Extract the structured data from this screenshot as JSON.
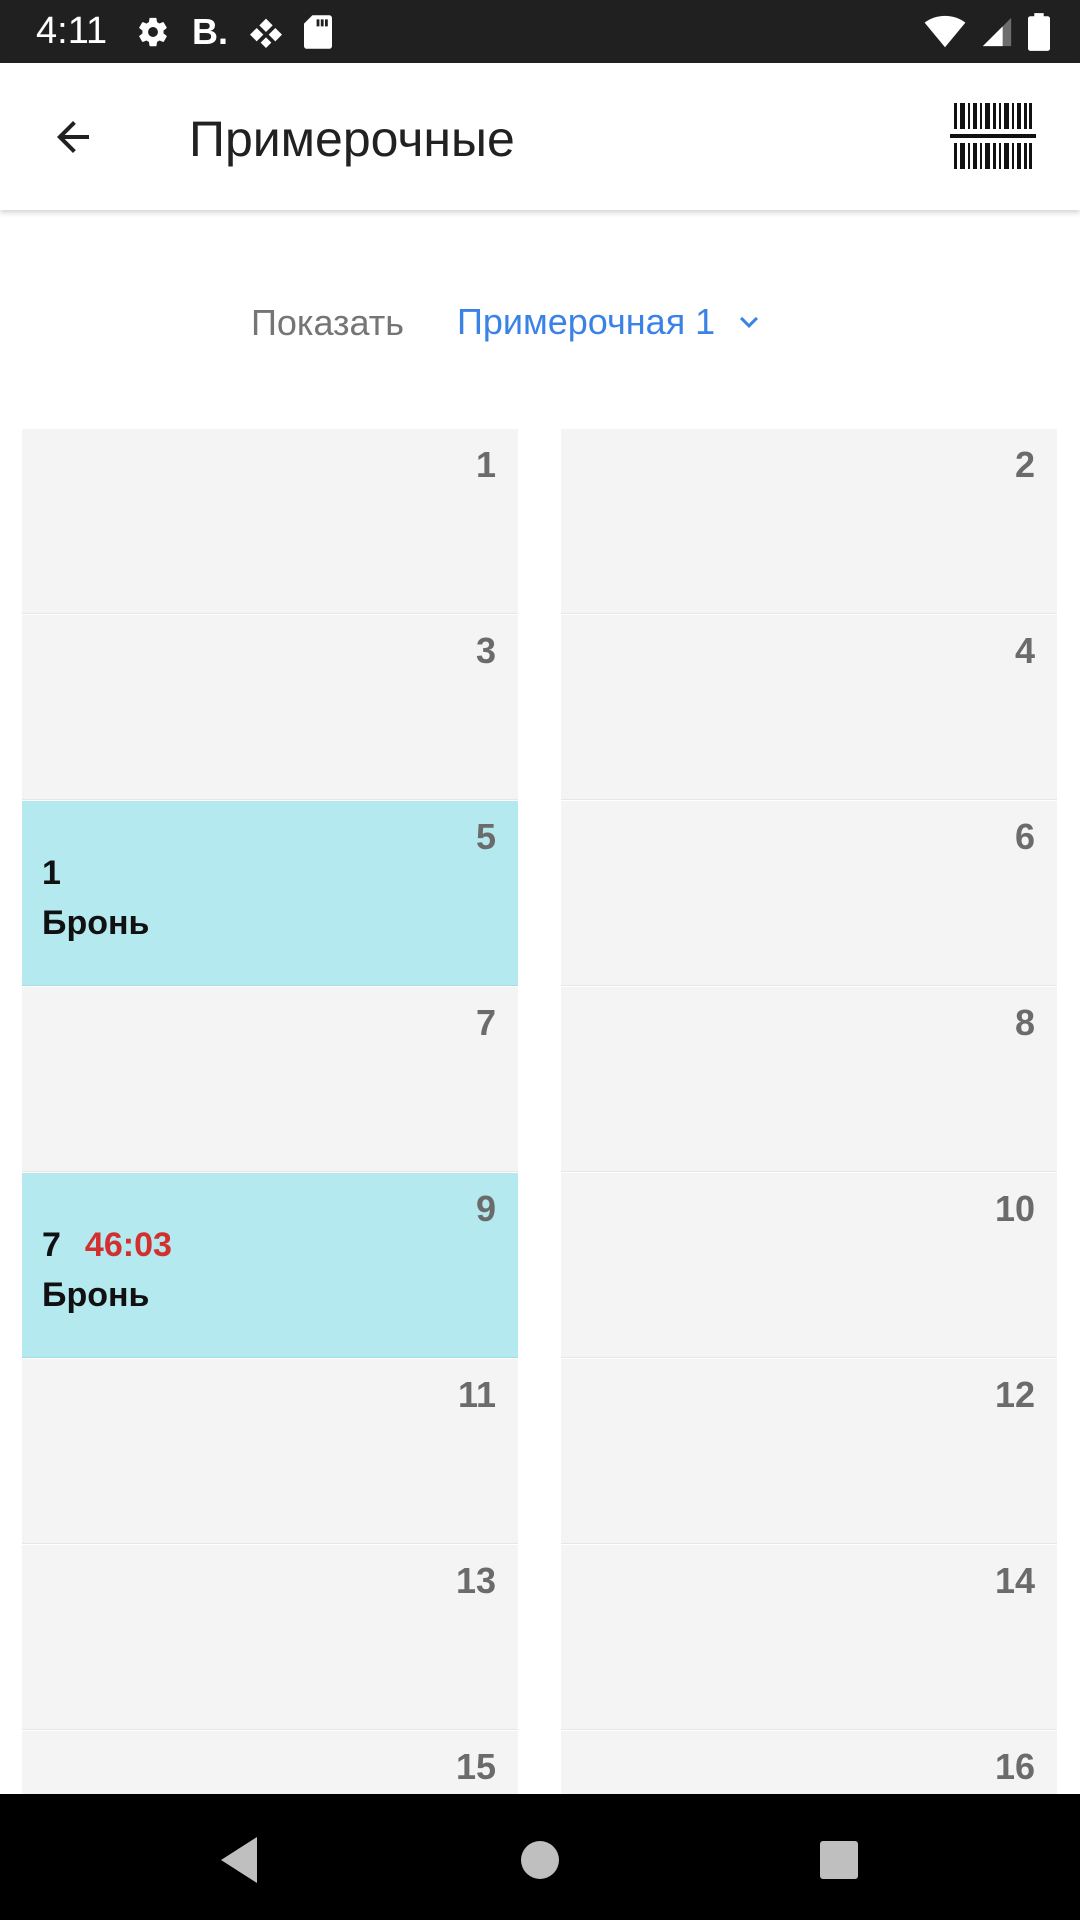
{
  "status_bar": {
    "time": "4:11",
    "letter": "B",
    "icons_left": [
      "gear-icon",
      "letter-b-icon",
      "diamond-dots-icon",
      "sd-card-icon"
    ],
    "icons_right": [
      "wifi-icon",
      "signal-icon",
      "battery-icon"
    ]
  },
  "app_bar": {
    "title": "Примерочные",
    "back_icon": "arrow-back-icon",
    "action_icon": "barcode-icon"
  },
  "filter": {
    "label": "Показать",
    "selected": "Примерочная 1",
    "accent_color": "#3b82e6"
  },
  "slots": [
    {
      "number": "1",
      "booked": false
    },
    {
      "number": "2",
      "booked": false
    },
    {
      "number": "3",
      "booked": false
    },
    {
      "number": "4",
      "booked": false
    },
    {
      "number": "5",
      "booked": true,
      "id": "1",
      "timer": "",
      "status": "Бронь"
    },
    {
      "number": "6",
      "booked": false
    },
    {
      "number": "7",
      "booked": false
    },
    {
      "number": "8",
      "booked": false
    },
    {
      "number": "9",
      "booked": true,
      "id": "7",
      "timer": "46:03",
      "status": "Бронь"
    },
    {
      "number": "10",
      "booked": false
    },
    {
      "number": "11",
      "booked": false
    },
    {
      "number": "12",
      "booked": false
    },
    {
      "number": "13",
      "booked": false
    },
    {
      "number": "14",
      "booked": false
    },
    {
      "number": "15",
      "booked": false
    },
    {
      "number": "16",
      "booked": false
    }
  ],
  "colors": {
    "booked_bg": "#b3e9ef",
    "free_bg": "#f4f4f4",
    "timer": "#d32f2f"
  },
  "nav_bar": {
    "buttons": [
      "nav-back-icon",
      "nav-home-icon",
      "nav-recents-icon"
    ]
  }
}
